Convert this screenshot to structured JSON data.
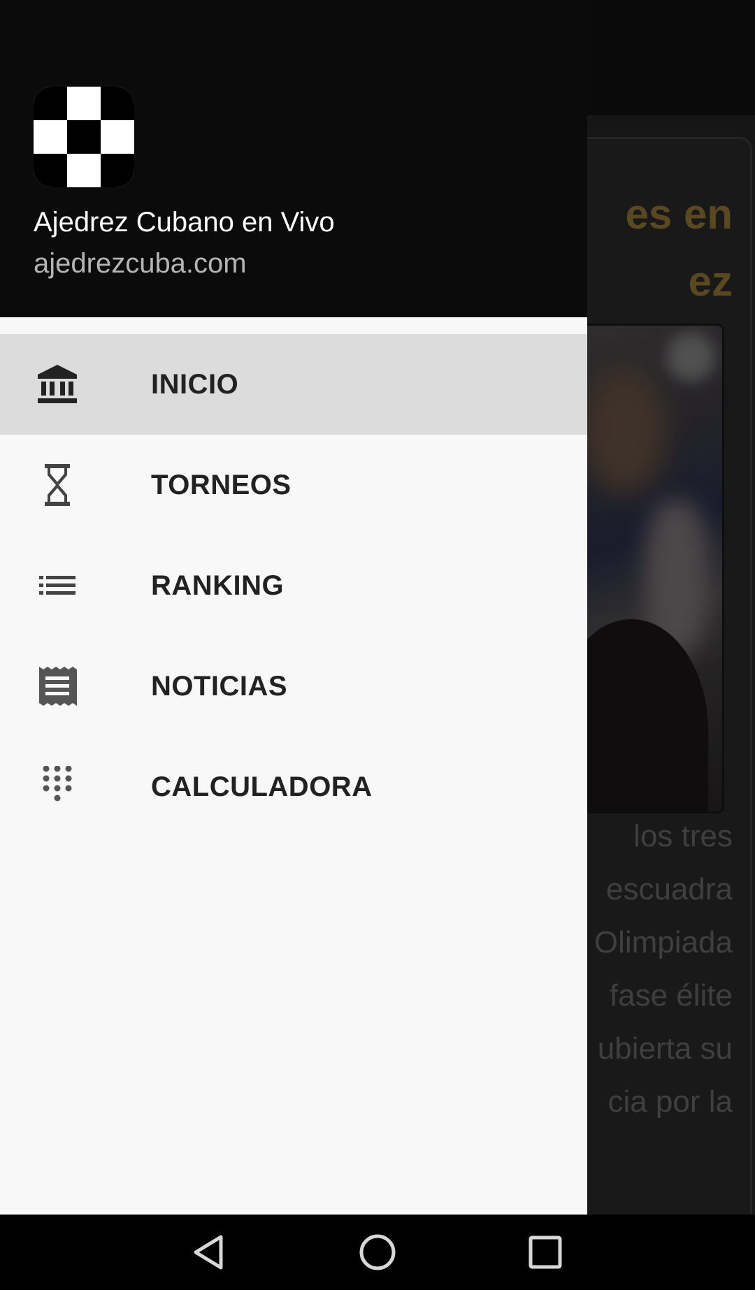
{
  "background": {
    "heading_line1": "es    en",
    "heading_line2": "ez",
    "body_lines": [
      "los   tres",
      "escuadra",
      "Olimpiada",
      "fase  élite",
      "ubierta su",
      "cia por la"
    ]
  },
  "drawer": {
    "header": {
      "logo_icon": "chessboard-logo-icon",
      "title": "Ajedrez Cubano en Vivo",
      "subtitle": "ajedrezcuba.com"
    },
    "items": [
      {
        "label": "INICIO",
        "icon": "bank-icon",
        "active": true
      },
      {
        "label": "TORNEOS",
        "icon": "hourglass-icon",
        "active": false
      },
      {
        "label": "RANKING",
        "icon": "list-icon",
        "active": false
      },
      {
        "label": "NOTICIAS",
        "icon": "receipt-icon",
        "active": false
      },
      {
        "label": "CALCULADORA",
        "icon": "dialpad-icon",
        "active": false
      }
    ]
  },
  "navbar": {
    "back": "back-icon",
    "home": "home-icon",
    "recents": "recents-icon"
  },
  "colors": {
    "drawer_bg": "#f8f8f8",
    "header_bg": "#0b0b0b",
    "active_item_bg": "#dcdcdc",
    "label_color": "#222222",
    "icon_color": "#333333"
  }
}
